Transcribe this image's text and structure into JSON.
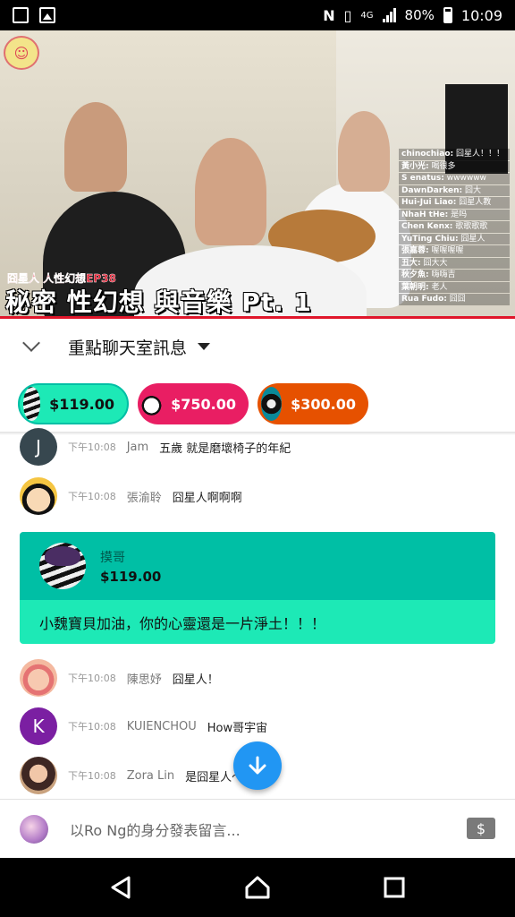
{
  "status_bar": {
    "network": "4G",
    "battery": "80%",
    "time": "10:09"
  },
  "video": {
    "subtitle": "囧星人 人性幻想EP38",
    "title": "秘密 性幻想 與音樂 Pt. 1",
    "overlay_chat": [
      {
        "name": "chinochiao:",
        "text": "囧星人！！！"
      },
      {
        "name": "黃小光:",
        "text": "喝很多"
      },
      {
        "name": "S enatus:",
        "text": "wwwwww"
      },
      {
        "name": "DawnDarken:",
        "text": "囧大"
      },
      {
        "name": "Hui-Jui Liao:",
        "text": "囧星人教"
      },
      {
        "name": "NhaH tHe:",
        "text": "是吗"
      },
      {
        "name": "Chen Kenx:",
        "text": "歌歌歌歌"
      },
      {
        "name": "YuTing Chiu:",
        "text": "囧星人"
      },
      {
        "name": "張嘉蓉:",
        "text": "喔喔喔喔"
      },
      {
        "name": "丑大:",
        "text": "囧大大"
      },
      {
        "name": "秋夕魚:",
        "text": "嗨嗨吉"
      },
      {
        "name": "葉朝明:",
        "text": "老人"
      },
      {
        "name": "Rua Fudo:",
        "text": "囧囧"
      }
    ]
  },
  "chat_header": {
    "title": "重點聊天室訊息"
  },
  "chips": [
    {
      "amount": "$119.00",
      "color": "#1de9b6"
    },
    {
      "amount": "$750.00",
      "color": "#e91e63"
    },
    {
      "amount": "$300.00",
      "color": "#e65100"
    }
  ],
  "messages": [
    {
      "avatar": "J",
      "avatar_color": "#37474f",
      "time": "下午10:08",
      "author": "Jam",
      "text": "五歲 就是磨壞椅子的年紀"
    },
    {
      "avatar": "",
      "avatar_color": "#f5c542",
      "time": "下午10:08",
      "author": "張渝聆",
      "text": "囧星人啊啊啊"
    },
    {
      "avatar": "",
      "avatar_color": "#f4b9a0",
      "time": "下午10:08",
      "author": "陳思妤",
      "text": "囧星人！"
    },
    {
      "avatar": "K",
      "avatar_color": "#7b1fa2",
      "time": "下午10:08",
      "author": "KUIENCHOU",
      "text": "How哥宇宙"
    },
    {
      "avatar": "",
      "avatar_color": "#6d4c41",
      "time": "下午10:08",
      "author": "Zora Lin",
      "text": "是囧星人～晚安"
    }
  ],
  "super_chat": {
    "name": "摸哥",
    "amount": "$119.00",
    "message": "小魏寶貝加油，你的心靈還是一片淨土！！！"
  },
  "input": {
    "placeholder": "以Ro Ng的身分發表留言..."
  },
  "icons": {
    "scroll_down": "arrow-down-icon",
    "super_chat_button": "currency-icon",
    "nav": [
      "back-icon",
      "home-icon",
      "recents-icon"
    ]
  }
}
